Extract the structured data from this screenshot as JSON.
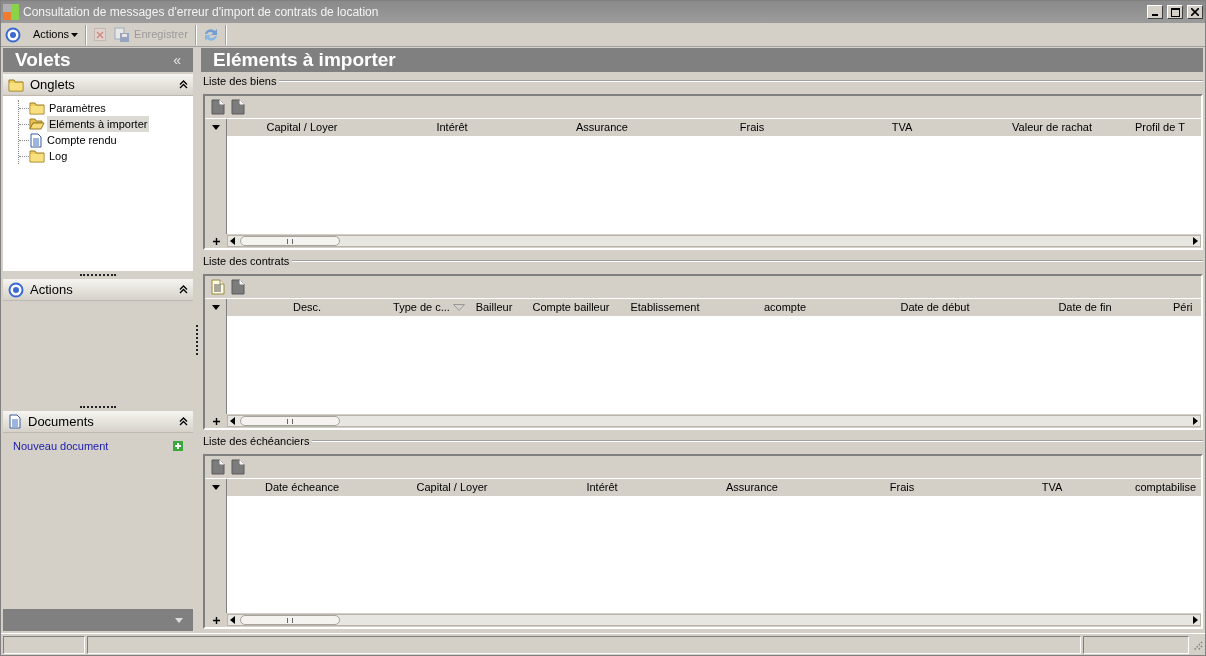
{
  "window": {
    "title": "Consultation de messages d'erreur d'import de contrats de location"
  },
  "toolbar": {
    "actions_menu": {
      "label": "Actions"
    },
    "delete": {
      "disabled": true
    },
    "save": {
      "label": "Enregistrer",
      "disabled": true
    },
    "refresh": {
      "disabled": false
    }
  },
  "sidebar": {
    "title": "Volets",
    "collapse_glyph": "«",
    "panels": [
      {
        "kind": "tree",
        "title": "Onglets",
        "expanded": true,
        "items": [
          {
            "kind": "folder",
            "label": "Paramètres",
            "selected": false
          },
          {
            "kind": "folder",
            "label": "Eléments à importer",
            "selected": true
          },
          {
            "kind": "document",
            "label": "Compte rendu",
            "selected": false
          },
          {
            "kind": "folder",
            "label": "Log",
            "selected": false
          }
        ]
      },
      {
        "kind": "actions",
        "title": "Actions",
        "expanded": true
      },
      {
        "kind": "documents",
        "title": "Documents",
        "expanded": true,
        "links": [
          {
            "label": "Nouveau document"
          }
        ]
      }
    ]
  },
  "main": {
    "title": "Eléments à importer",
    "sections": [
      {
        "title": "Liste des biens",
        "add_enabled": false,
        "columns": [
          {
            "label": "Capital / Loyer",
            "filtered": false
          },
          {
            "label": "Intérêt",
            "filtered": false
          },
          {
            "label": "Assurance",
            "filtered": false
          },
          {
            "label": "Frais",
            "filtered": false
          },
          {
            "label": "TVA",
            "filtered": false
          },
          {
            "label": "Valeur de rachat",
            "filtered": false
          },
          {
            "label": "Profil de T",
            "filtered": false
          }
        ]
      },
      {
        "title": "Liste des contrats",
        "add_enabled": true,
        "columns": [
          {
            "label": "Desc.",
            "filtered": false
          },
          {
            "label": "Type de c...",
            "filtered": true
          },
          {
            "label": "Bailleur",
            "filtered": false
          },
          {
            "label": "Compte bailleur",
            "filtered": false
          },
          {
            "label": "Etablissement",
            "filtered": false
          },
          {
            "label": "acompte",
            "filtered": false
          },
          {
            "label": "Date de début",
            "filtered": false
          },
          {
            "label": "Date de fin",
            "filtered": false
          },
          {
            "label": "Péri",
            "filtered": false
          }
        ]
      },
      {
        "title": "Liste des échéanciers",
        "add_enabled": false,
        "columns": [
          {
            "label": "Date écheance",
            "filtered": false
          },
          {
            "label": "Capital / Loyer",
            "filtered": false
          },
          {
            "label": "Intérêt",
            "filtered": false
          },
          {
            "label": "Assurance",
            "filtered": false
          },
          {
            "label": "Frais",
            "filtered": false
          },
          {
            "label": "TVA",
            "filtered": false
          },
          {
            "label": "comptabilise",
            "filtered": false
          }
        ]
      }
    ]
  }
}
